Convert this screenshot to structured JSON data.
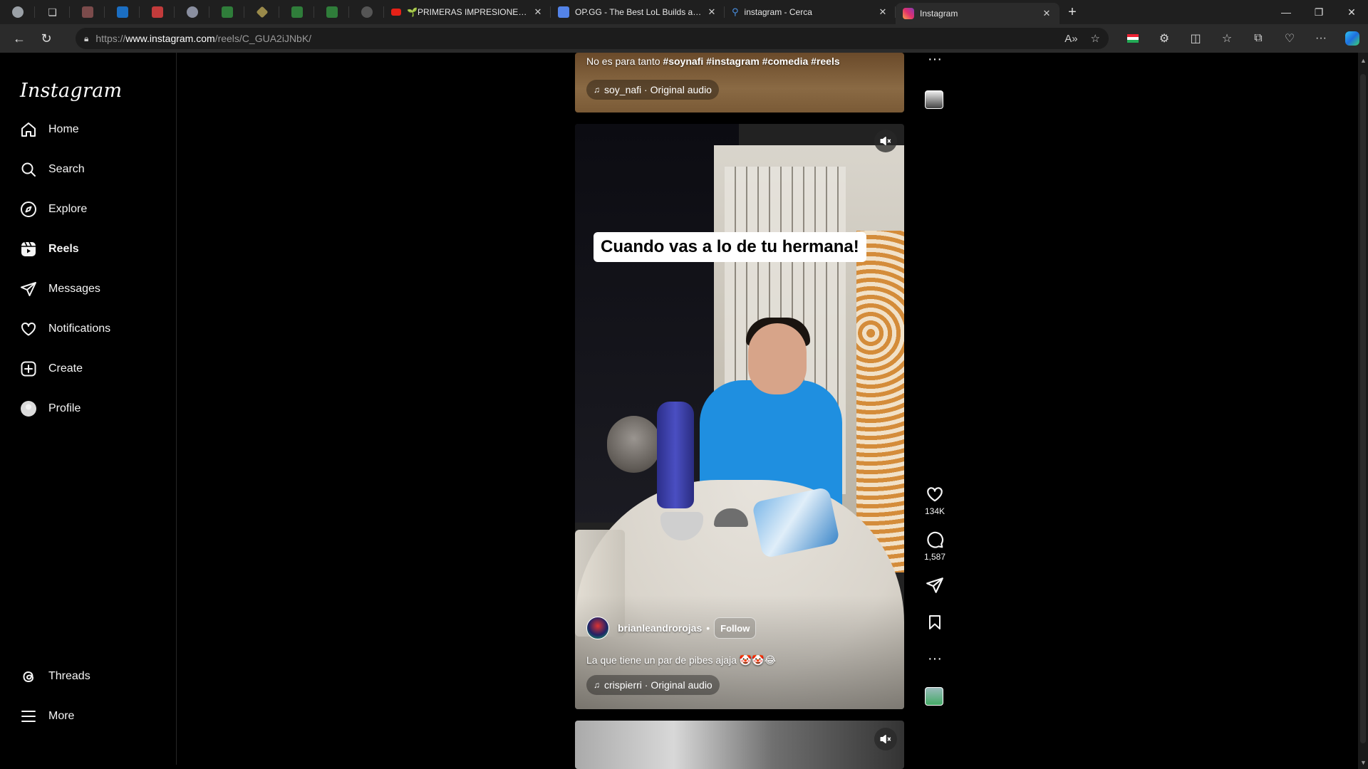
{
  "browser": {
    "pinned_tabs": [
      {
        "icon": "profile-icon",
        "color": "#9aa0a6"
      },
      {
        "icon": "workspaces-icon",
        "color": "#cfcfcf"
      },
      {
        "icon": "tab-favicon-doc",
        "color": "#7b4b4b"
      },
      {
        "icon": "outlook-icon",
        "color": "#1b6ec2"
      },
      {
        "icon": "tab-favicon-red",
        "color": "#c23b3b"
      },
      {
        "icon": "tab-favicon-check",
        "color": "#8a8fa0"
      },
      {
        "icon": "tab-favicon-sheet",
        "color": "#2f7d3a"
      },
      {
        "icon": "tab-favicon-diamond",
        "color": "#9a8a4a"
      },
      {
        "icon": "tab-favicon-sheet",
        "color": "#2f7d3a"
      },
      {
        "icon": "tab-favicon-sheet",
        "color": "#2f7d3a"
      },
      {
        "icon": "tab-favicon-gray",
        "color": "#555"
      }
    ],
    "tabs": [
      {
        "title": "🌱PRIMERAS IMPRESIONES de K",
        "favicon": "youtube-icon",
        "color": "#e62117"
      },
      {
        "title": "OP.GG - The Best LoL Builds and T",
        "favicon": "opgg-icon",
        "color": "#5383e8"
      },
      {
        "title": "instagram - Cerca",
        "favicon": "bing-search-icon",
        "color": "#4a90e2"
      },
      {
        "title": "Instagram",
        "favicon": "instagram-icon",
        "color": "#e1306c"
      }
    ],
    "url": {
      "scheme": "https://",
      "host": "www.instagram.com",
      "path": "/reels/C_GUA2iJNbK/"
    }
  },
  "sidebar": {
    "logo": "Instagram",
    "items": [
      {
        "label": "Home",
        "icon": "home-icon"
      },
      {
        "label": "Search",
        "icon": "search-icon"
      },
      {
        "label": "Explore",
        "icon": "explore-icon"
      },
      {
        "label": "Reels",
        "icon": "reels-icon"
      },
      {
        "label": "Messages",
        "icon": "messages-icon"
      },
      {
        "label": "Notifications",
        "icon": "heart-icon"
      },
      {
        "label": "Create",
        "icon": "create-icon"
      },
      {
        "label": "Profile",
        "icon": "profile-avatar-icon"
      }
    ],
    "bottom_items": [
      {
        "label": "Threads",
        "icon": "threads-icon"
      },
      {
        "label": "More",
        "icon": "menu-icon"
      }
    ]
  },
  "reel_previous": {
    "caption_prefix": "No es para tanto ",
    "hashtags": "#soynafi #instagram #comedia #reels",
    "audio": "soy_nafi · Original audio"
  },
  "reel_current": {
    "overlay_text": "Cuando vas a lo de tu hermana!",
    "author": "brianleandrorojas",
    "separator": "•",
    "follow_label": "Follow",
    "caption": "La que tiene un par de pibes ajaja 🤡🤡😂",
    "audio": "crispierri · Original audio",
    "likes": "134K",
    "comments": "1,587"
  }
}
